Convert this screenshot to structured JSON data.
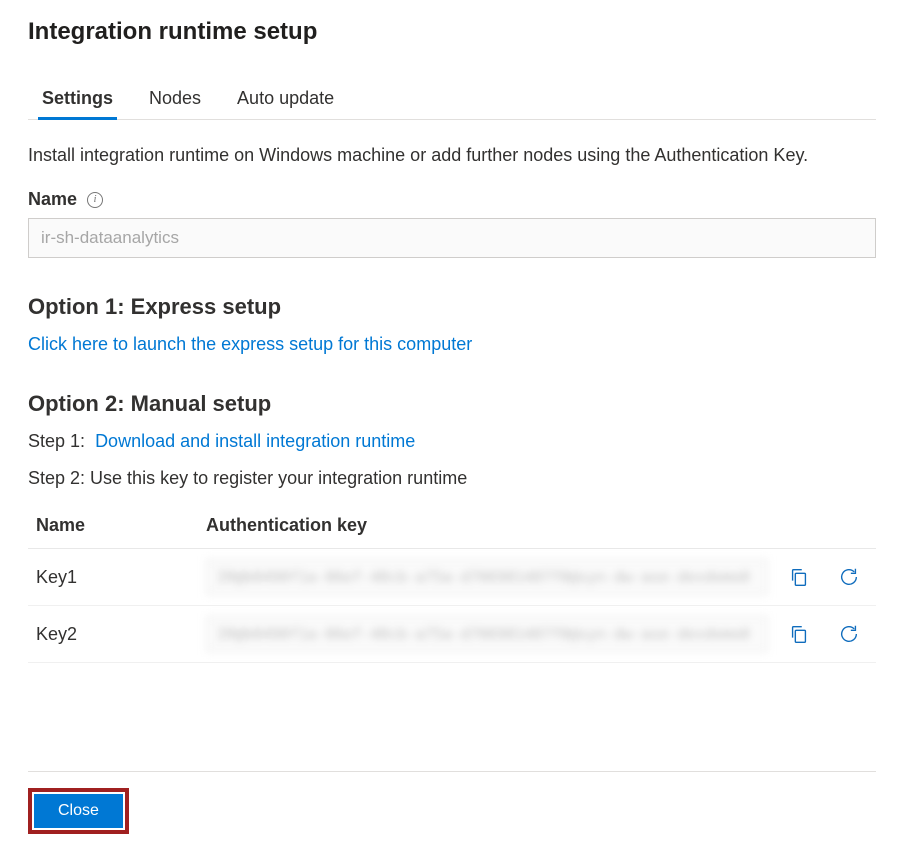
{
  "title": "Integration runtime setup",
  "tabs": {
    "settings": "Settings",
    "nodes": "Nodes",
    "auto_update": "Auto update",
    "active": "settings"
  },
  "description": "Install integration runtime on Windows machine or add further nodes using the Authentication Key.",
  "name_field": {
    "label": "Name",
    "value": "ir-sh-dataanalytics"
  },
  "option1": {
    "heading": "Option 1: Express setup",
    "link": "Click here to launch the express setup for this computer"
  },
  "option2": {
    "heading": "Option 2: Manual setup",
    "step1_label": "Step 1:",
    "step1_link": "Download and install integration runtime",
    "step2": "Step 2: Use this key to register your integration runtime"
  },
  "keys_table": {
    "col_name": "Name",
    "col_authkey": "Authentication key",
    "rows": [
      {
        "name": "Key1",
        "value": "IR@b0490f1a-06ef-40cb-a75a-d706981407f0@syn-dw-ase-devdemo0"
      },
      {
        "name": "Key2",
        "value": "IR@b0490f1a-06ef-40cb-a75a-d706981407f0@syn-dw-ase-devdemo0"
      }
    ]
  },
  "footer": {
    "close_label": "Close"
  }
}
